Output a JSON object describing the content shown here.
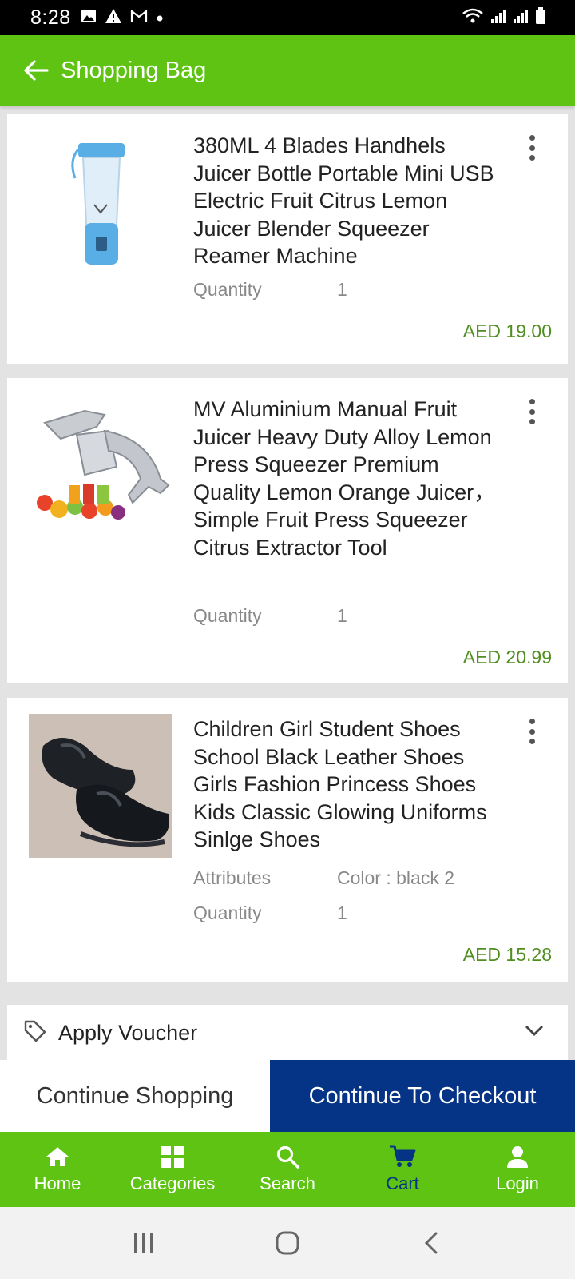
{
  "status_bar": {
    "time": "8:28",
    "left_icons": [
      "image-icon",
      "warning-icon",
      "mail-icon",
      "dot-icon"
    ],
    "right_icons": [
      "wifi-icon",
      "signal-icon",
      "signal-icon",
      "battery-icon"
    ]
  },
  "app_bar": {
    "title": "Shopping Bag"
  },
  "colors": {
    "brand_green": "#5ec313",
    "checkout_blue": "#053386",
    "price_green": "#4f8e1f"
  },
  "cart": {
    "items": [
      {
        "title": "380ML 4 Blades Handhels Juicer Bottle Portable Mini USB Electric Fruit Citrus Lemon Juicer Blender Squeezer Reamer Machine",
        "quantity_label": "Quantity",
        "quantity": "1",
        "price": "AED 19.00"
      },
      {
        "title": "MV Aluminium Manual Fruit Juicer Heavy Duty Alloy Lemon Press Squeezer Premium Quality Lemon Orange Juicer，Simple Fruit Press Squeezer Citrus Extractor Tool",
        "quantity_label": "Quantity",
        "quantity": "1",
        "price": "AED 20.99"
      },
      {
        "title": "Children Girl Student Shoes School Black Leather Shoes Girls Fashion Princess Shoes Kids Classic Glowing Uniforms Sinlge Shoes",
        "attributes_label": "Attributes",
        "attributes_value": "Color : black 2",
        "quantity_label": "Quantity",
        "quantity": "1",
        "price": "AED 15.28"
      }
    ]
  },
  "voucher": {
    "label": "Apply Voucher"
  },
  "actions": {
    "continue_shopping": "Continue Shopping",
    "checkout": "Continue To Checkout"
  },
  "bottom_nav": {
    "items": [
      {
        "label": "Home",
        "icon": "home-icon"
      },
      {
        "label": "Categories",
        "icon": "grid-icon"
      },
      {
        "label": "Search",
        "icon": "search-icon"
      },
      {
        "label": "Cart",
        "icon": "cart-icon",
        "active": true
      },
      {
        "label": "Login",
        "icon": "person-icon"
      }
    ]
  }
}
